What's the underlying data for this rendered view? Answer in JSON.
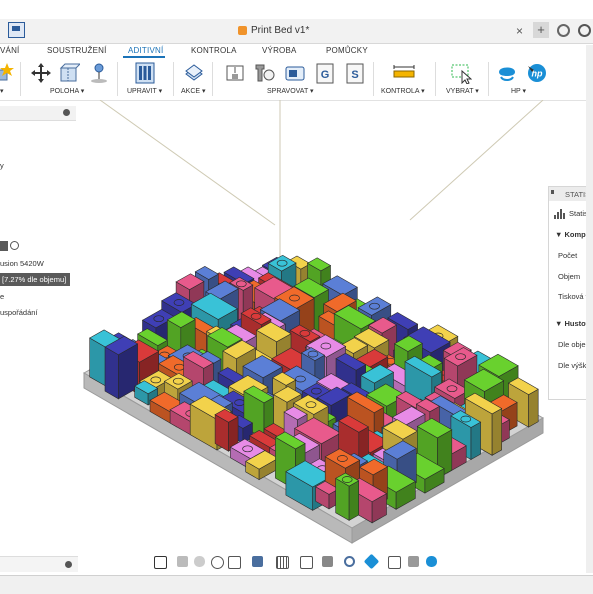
{
  "window": {
    "document_title": "Print Bed v1*",
    "close_glyph": "×",
    "new_tab_glyph": "+"
  },
  "ribbon": {
    "tabs": [
      {
        "label": "VÁNÍ"
      },
      {
        "label": "SOUSTRUŽENÍ"
      },
      {
        "label": "ADITIVNÍ",
        "active": true
      },
      {
        "label": "KONTROLA"
      },
      {
        "label": "VÝROBA"
      },
      {
        "label": "POMŮCKY"
      }
    ],
    "groups": [
      {
        "label": "▾"
      },
      {
        "label": "POLOHA ▾"
      },
      {
        "label": "UPRAVIT ▾"
      },
      {
        "label": "AKCE ▾"
      },
      {
        "label": "SPRAVOVAT ▾"
      },
      {
        "label": "KONTROLA ▾"
      },
      {
        "label": "VYBRAT ▾"
      },
      {
        "label": "HP ▾"
      }
    ]
  },
  "left_panel": {
    "item_y": "y",
    "machine": "usion 5420W",
    "selected": "[7.27% dle objemu]",
    "item_e": "e",
    "arrangement": "uspořádání"
  },
  "right_panel": {
    "header": "STATIST",
    "stats_label": "Statistik",
    "components_heading": "Kompo",
    "count": "Počet",
    "volume": "Objem",
    "printable": "Tisková vý",
    "density_heading": "Hustota",
    "by_volume": "Dle objemu",
    "by_height": "Dle výšky t"
  },
  "colors": {
    "accent": "#1b73b8",
    "hp_blue": "#1a8fd6",
    "bed": "#c9c9c9",
    "parts": [
      "#f2d24b",
      "#e85a8c",
      "#3f3fb5",
      "#f06a2a",
      "#d93a3a",
      "#39c2d7",
      "#69d12e",
      "#e78be6",
      "#5b7fd6"
    ]
  }
}
